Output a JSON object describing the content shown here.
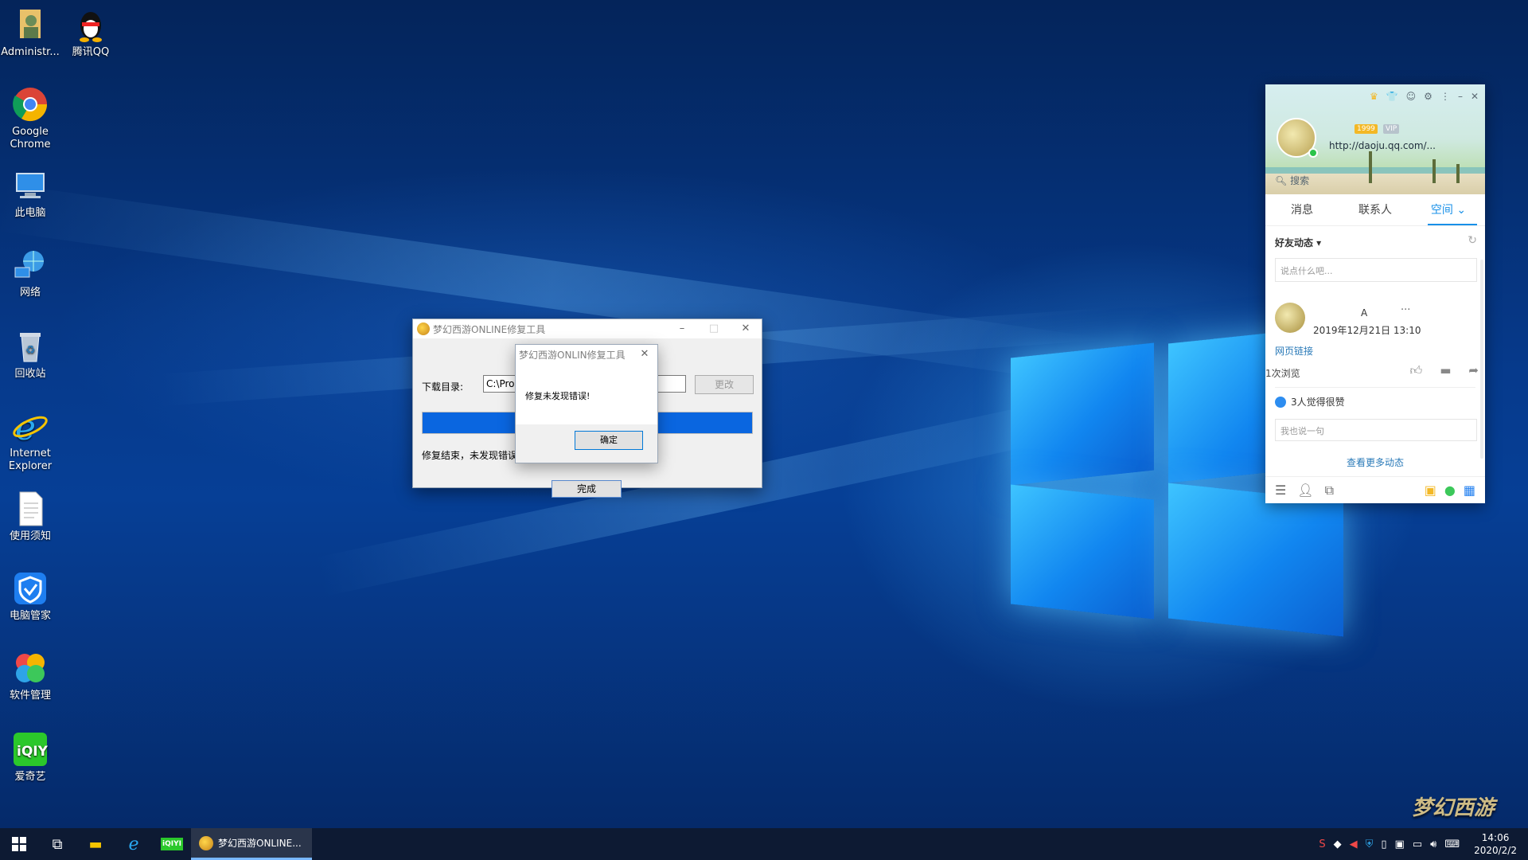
{
  "desktop": {
    "icons": [
      {
        "label": "Administr...",
        "icon": "user-folder-icon"
      },
      {
        "label": "腾讯QQ",
        "icon": "qq-penguin-icon"
      },
      {
        "label": "Google Chrome",
        "icon": "chrome-icon"
      },
      {
        "label": "此电脑",
        "icon": "computer-icon"
      },
      {
        "label": "网络",
        "icon": "network-icon"
      },
      {
        "label": "回收站",
        "icon": "recycle-bin-icon"
      },
      {
        "label": "Internet Explorer",
        "icon": "ie-icon"
      },
      {
        "label": "使用须知",
        "icon": "document-icon"
      },
      {
        "label": "电脑管家",
        "icon": "shield-icon"
      },
      {
        "label": "软件管理",
        "icon": "software-manager-icon"
      },
      {
        "label": "爱奇艺",
        "icon": "iqiyi-icon"
      }
    ]
  },
  "repair_window": {
    "title": "梦幻西游ONLINE修复工具",
    "dir_label": "下载目录:",
    "dir_value": "C:\\Prog",
    "change_button": "更改",
    "progress_fraction": 1.0,
    "status": "修复结束，未发现错误",
    "done_button": "完成",
    "minimize": "–",
    "maximize": "□",
    "close": "✕"
  },
  "message_box": {
    "title": "梦幻西游ONLIN修复工具",
    "text": "修复未发现错误!",
    "ok_button": "确定",
    "close": "✕"
  },
  "qq_panel": {
    "signature": "http://daoju.qq.com/...",
    "vip_badge": "1999",
    "vip_badge2": "VIP",
    "search_placeholder": "搜索",
    "tabs": [
      {
        "label": "消息"
      },
      {
        "label": "联系人"
      },
      {
        "label": "空间 ⌄"
      }
    ],
    "section_title": "好友动态 ▾",
    "post_placeholder": "说点什么吧...",
    "feed": {
      "name": "A",
      "more": "···",
      "time": "2019年12月21日 13:10",
      "link": "网页链接",
      "views": "1次浏览",
      "likes": "3人觉得很赞",
      "comment_placeholder": "我也说一句"
    },
    "more_feed": "查看更多动态"
  },
  "taskbar": {
    "active_app": "梦幻西游ONLINE...",
    "time": "14:06",
    "date": "2020/2/2"
  },
  "watermark": "梦幻西游"
}
